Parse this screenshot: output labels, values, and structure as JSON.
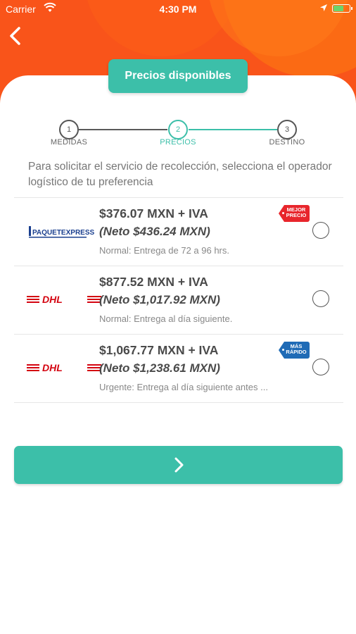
{
  "status_bar": {
    "carrier": "Carrier",
    "time": "4:30 PM"
  },
  "header": {
    "title": "Precios disponibles",
    "back_icon": "chevron-left-icon"
  },
  "stepper": {
    "steps": [
      {
        "number": "1",
        "label": "MEDIDAS",
        "active": false
      },
      {
        "number": "2",
        "label": "PRECIOS",
        "active": true
      },
      {
        "number": "3",
        "label": "DESTINO",
        "active": false
      }
    ]
  },
  "instructions": "Para solicitar el servicio de recolección, selecciona el operador logístico de tu preferencia",
  "options": [
    {
      "carrier": "PAQUETEXPRESS",
      "price": "$376.07 MXN + IVA",
      "neto": "(Neto $436.24 MXN)",
      "description": "Normal: Entrega de 72 a 96 hrs.",
      "badge": {
        "line1": "MEJOR",
        "line2": "PRECIO"
      },
      "selected": false
    },
    {
      "carrier": "DHL",
      "price": "$877.52 MXN + IVA",
      "neto": "(Neto $1,017.92 MXN)",
      "description": "Normal: Entrega al día siguiente.",
      "selected": false
    },
    {
      "carrier": "DHL",
      "price": "$1,067.77 MXN + IVA",
      "neto": "(Neto $1,238.61 MXN)",
      "description": "Urgente: Entrega al día siguiente antes ...",
      "badge": {
        "line1": "MÁS",
        "line2": "RÁPIDO"
      },
      "selected": false
    }
  ],
  "next_button": {
    "icon": "chevron-right-icon"
  },
  "colors": {
    "accent": "#3cbfa9",
    "header": "#f9541a",
    "badge_red": "#e8262c",
    "badge_blue": "#1f6bb6",
    "dhl_red": "#d40511"
  }
}
